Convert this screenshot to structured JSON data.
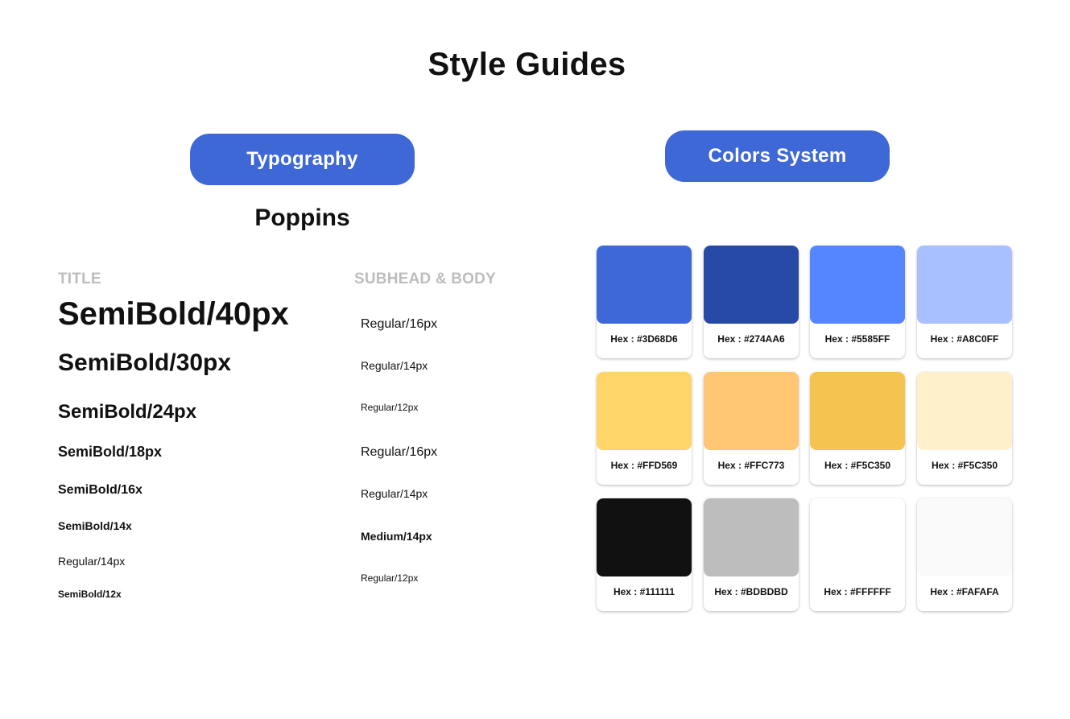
{
  "title": "Style Guides",
  "typography": {
    "button_label": "Typography",
    "font_name": "Poppins",
    "title_heading": "TITLE",
    "body_heading": "SUBHEAD & BODY",
    "title_samples": [
      "SemiBold/40px",
      "SemiBold/30px",
      "SemiBold/24px",
      "SemiBold/18px",
      "SemiBold/16x",
      "SemiBold/14x",
      "Regular/14px",
      "SemiBold/12x"
    ],
    "body_samples": [
      "Regular/16px",
      "Regular/14px",
      "Regular/12px",
      "Regular/16px",
      "Regular/14px",
      "Medium/14px",
      "Regular/12px"
    ]
  },
  "colors": {
    "button_label": "Colors System",
    "swatches": [
      {
        "label": "Hex : #3D68D6",
        "color": "#3D68D6"
      },
      {
        "label": "Hex : #274AA6",
        "color": "#274AA6"
      },
      {
        "label": "Hex : #5585FF",
        "color": "#5585FF"
      },
      {
        "label": "Hex : #A8C0FF",
        "color": "#A8C0FF"
      },
      {
        "label": "Hex : #FFD569",
        "color": "#FFD569"
      },
      {
        "label": "Hex : #FFC773",
        "color": "#FFC773"
      },
      {
        "label": "Hex : #F5C350",
        "color": "#F5C350"
      },
      {
        "label": "Hex : #F5C350",
        "color": "#FFF0CB"
      },
      {
        "label": "Hex : #111111",
        "color": "#111111"
      },
      {
        "label": "Hex : #BDBDBD",
        "color": "#BDBDBD"
      },
      {
        "label": "Hex : #FFFFFF",
        "color": "#FFFFFF"
      },
      {
        "label": "Hex : #FAFAFA",
        "color": "#FAFAFA"
      }
    ]
  }
}
